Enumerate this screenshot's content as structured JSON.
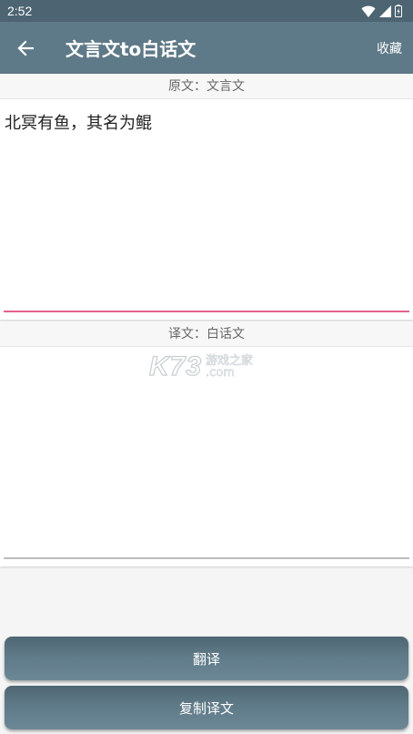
{
  "status_bar": {
    "time": "2:52",
    "icons": [
      "wifi-icon",
      "signal-icon",
      "battery-icon"
    ]
  },
  "app_bar": {
    "back_icon": "arrow-left-icon",
    "title": "文言文to白话文",
    "favorite_label": "收藏"
  },
  "source": {
    "label": "原文：文言文",
    "text": "北冥有鱼，其名为鲲",
    "accent_color": "#e2628c"
  },
  "translation": {
    "label": "译文：白话文",
    "text": "",
    "underline_color": "#bdbdbd"
  },
  "watermark": {
    "logo": "K73",
    "line1": "游戏之家",
    "line2": ".com"
  },
  "buttons": {
    "translate_label": "翻译",
    "copy_label": "复制译文"
  },
  "colors": {
    "status_bar": "#4d6472",
    "app_bar": "#5e7987",
    "button": "#5f7a88"
  }
}
